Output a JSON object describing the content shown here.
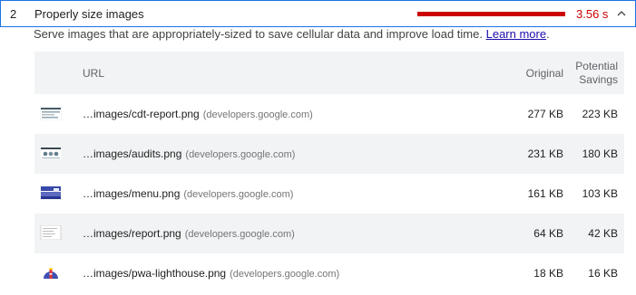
{
  "audit": {
    "number": "2",
    "title": "Properly size images",
    "time": "3.56 s",
    "description": "Serve images that are appropriately-sized to save cellular data and improve load time.",
    "learn_more": "Learn more",
    "period": ".",
    "bar_color": "#cc0000"
  },
  "table": {
    "headers": {
      "url": "URL",
      "original": "Original",
      "savings_line1": "Potential",
      "savings_line2": "Savings"
    },
    "rows": [
      {
        "path": "…images/cdt-report.png",
        "host": "(developers.google.com)",
        "original": "277 KB",
        "savings": "223 KB",
        "thumb": "cdt-report-thumbnail"
      },
      {
        "path": "…images/audits.png",
        "host": "(developers.google.com)",
        "original": "231 KB",
        "savings": "180 KB",
        "thumb": "audits-thumbnail"
      },
      {
        "path": "…images/menu.png",
        "host": "(developers.google.com)",
        "original": "161 KB",
        "savings": "103 KB",
        "thumb": "menu-thumbnail"
      },
      {
        "path": "…images/report.png",
        "host": "(developers.google.com)",
        "original": "64 KB",
        "savings": "42 KB",
        "thumb": "report-thumbnail"
      },
      {
        "path": "…images/pwa-lighthouse.png",
        "host": "(developers.google.com)",
        "original": "18 KB",
        "savings": "16 KB",
        "thumb": "pwa-lighthouse-thumbnail"
      }
    ]
  }
}
